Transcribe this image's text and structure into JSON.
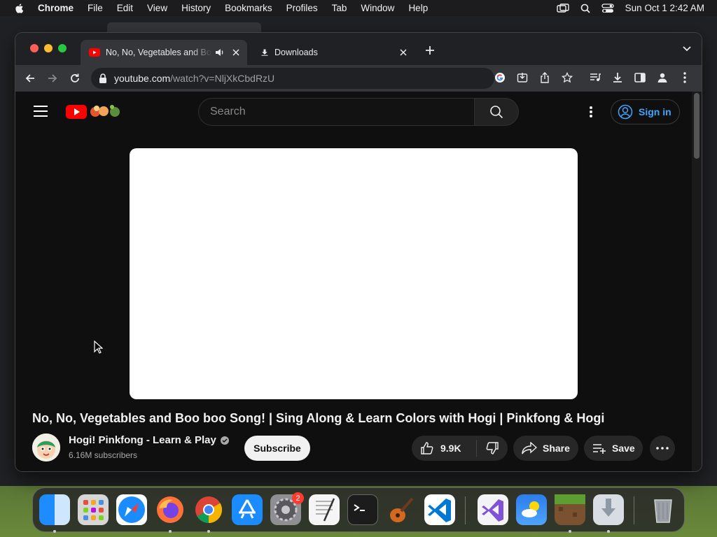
{
  "menubar": {
    "items": [
      "Chrome",
      "File",
      "Edit",
      "View",
      "History",
      "Bookmarks",
      "Profiles",
      "Tab",
      "Window",
      "Help"
    ],
    "datetime": "Sun Oct 1  2:42 AM"
  },
  "browser": {
    "tabs": [
      {
        "title": "No, No, Vegetables and Boo boo Song!",
        "icon": "youtube-favicon",
        "audio": true
      },
      {
        "title": "Downloads",
        "icon": "download-icon"
      }
    ],
    "url_host": "youtube.com",
    "url_path": "/watch?v=NljXkCbdRzU"
  },
  "youtube": {
    "search_placeholder": "Search",
    "sign_in": "Sign in",
    "video_title": "No, No, Vegetables and Boo boo Song! | Sing Along & Learn Colors with Hogi | Pinkfong & Hogi",
    "channel_name": "Hogi! Pinkfong - Learn & Play",
    "subscribers": "6.16M subscribers",
    "subscribe_label": "Subscribe",
    "likes": "9.9K",
    "share_label": "Share",
    "save_label": "Save"
  },
  "dock": {
    "apps": [
      "Finder",
      "Launchpad",
      "Safari",
      "Firefox",
      "Chrome",
      "App Store",
      "System Settings",
      "TextEdit",
      "Terminal",
      "GarageBand",
      "Visual Studio Code",
      "Visual Studio",
      "Weather",
      "Minecraft",
      "Downloads",
      "Trash"
    ],
    "settings_badge": "2"
  },
  "colors": {
    "youtube_red": "#ff0000",
    "link_blue": "#3ea6ff",
    "page_bg": "#0f0f0f"
  }
}
